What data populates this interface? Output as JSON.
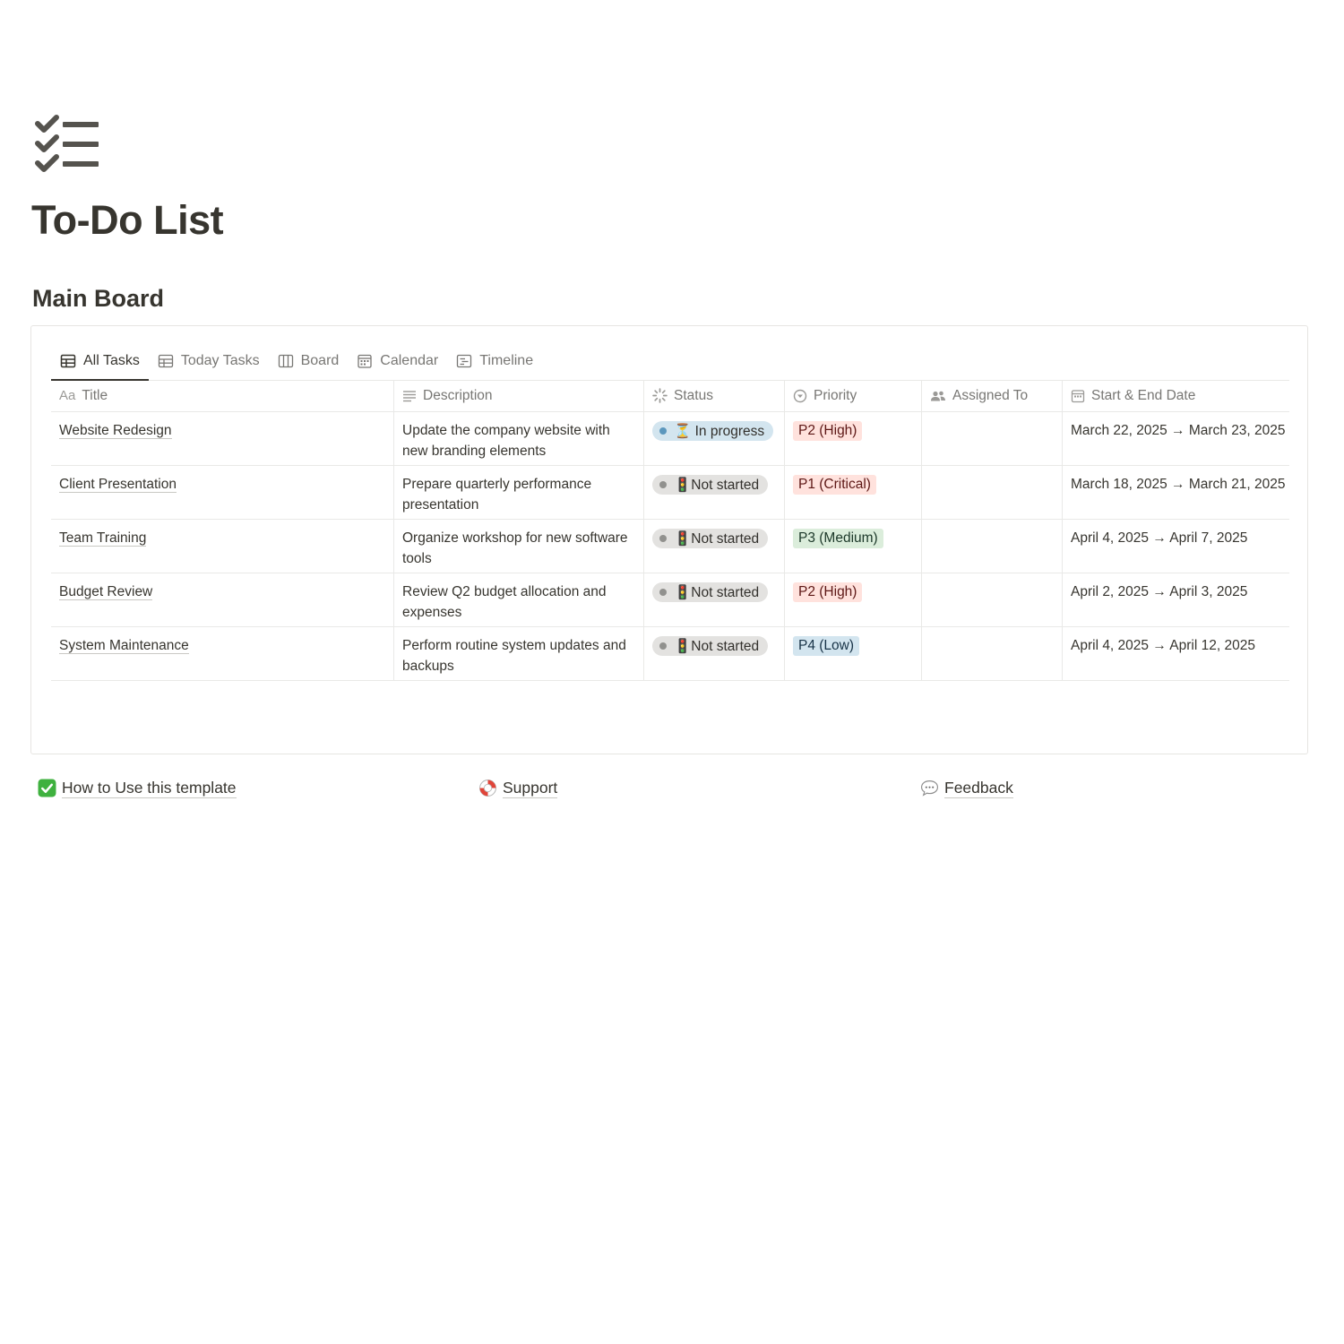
{
  "page": {
    "icon": "checklist-icon",
    "title": "To-Do List",
    "section_title": "Main Board"
  },
  "tabs": [
    {
      "label": "All Tasks",
      "icon": "table-icon",
      "active": true
    },
    {
      "label": "Today Tasks",
      "icon": "table-icon",
      "active": false
    },
    {
      "label": "Board",
      "icon": "board-icon",
      "active": false
    },
    {
      "label": "Calendar",
      "icon": "calendar-icon",
      "active": false
    },
    {
      "label": "Timeline",
      "icon": "timeline-icon",
      "active": false
    }
  ],
  "columns": {
    "title": {
      "label": "Title",
      "icon_text": "Aa"
    },
    "description": {
      "label": "Description",
      "icon": "text-lines-icon"
    },
    "status": {
      "label": "Status",
      "icon": "status-spinner-icon"
    },
    "priority": {
      "label": "Priority",
      "icon": "select-icon"
    },
    "assigned": {
      "label": "Assigned To",
      "icon": "people-icon"
    },
    "dates": {
      "label": "Start & End Date",
      "icon": "calendar-icon"
    }
  },
  "rows": [
    {
      "title": "Website Redesign",
      "description": "Update the company website with new branding elements",
      "status": "⏳ In progress",
      "priority": "P2 (High)",
      "assigned": "",
      "dates": "March 22, 2025 → March 23, 2025"
    },
    {
      "title": "Client Presentation",
      "description": "Prepare quarterly performance presentation",
      "status": "🚦Not started",
      "priority": "P1 (Critical)",
      "assigned": "",
      "dates": "March 18, 2025 → March 21, 2025"
    },
    {
      "title": "Team Training",
      "description": "Organize workshop for new software tools",
      "status": "🚦Not started",
      "priority": "P3 (Medium)",
      "assigned": "",
      "dates": "April 4, 2025 → April 7, 2025"
    },
    {
      "title": "Budget Review",
      "description": "Review Q2 budget allocation and expenses",
      "status": "🚦Not started",
      "priority": "P2 (High)",
      "assigned": "",
      "dates": "April 2, 2025 → April 3, 2025"
    },
    {
      "title": "System Maintenance",
      "description": "Perform routine system updates and backups",
      "status": "🚦Not started",
      "priority": "P4 (Low)",
      "assigned": "",
      "dates": "April 4, 2025 → April 12, 2025"
    }
  ],
  "colors": {
    "in_progress_bg": "#d3e5ef",
    "in_progress_dot": "#5b97bd",
    "not_started_bg": "#e3e2e0",
    "not_started_dot": "#91918e",
    "prio_high_bg": "#ffe2dd",
    "prio_high_fg": "#5d1715",
    "prio_critical_bg": "#ffe2dd",
    "prio_medium_bg": "#dbeddb",
    "prio_medium_fg": "#1c3829",
    "prio_low_bg": "#d3e5ef",
    "prio_low_fg": "#183347"
  },
  "footer": {
    "links": [
      {
        "label": "How to Use this template",
        "icon": "check-box-icon"
      },
      {
        "label": "Support",
        "icon": "lifebuoy-icon"
      },
      {
        "label": "Feedback",
        "icon": "speech-bubble-icon"
      }
    ]
  }
}
